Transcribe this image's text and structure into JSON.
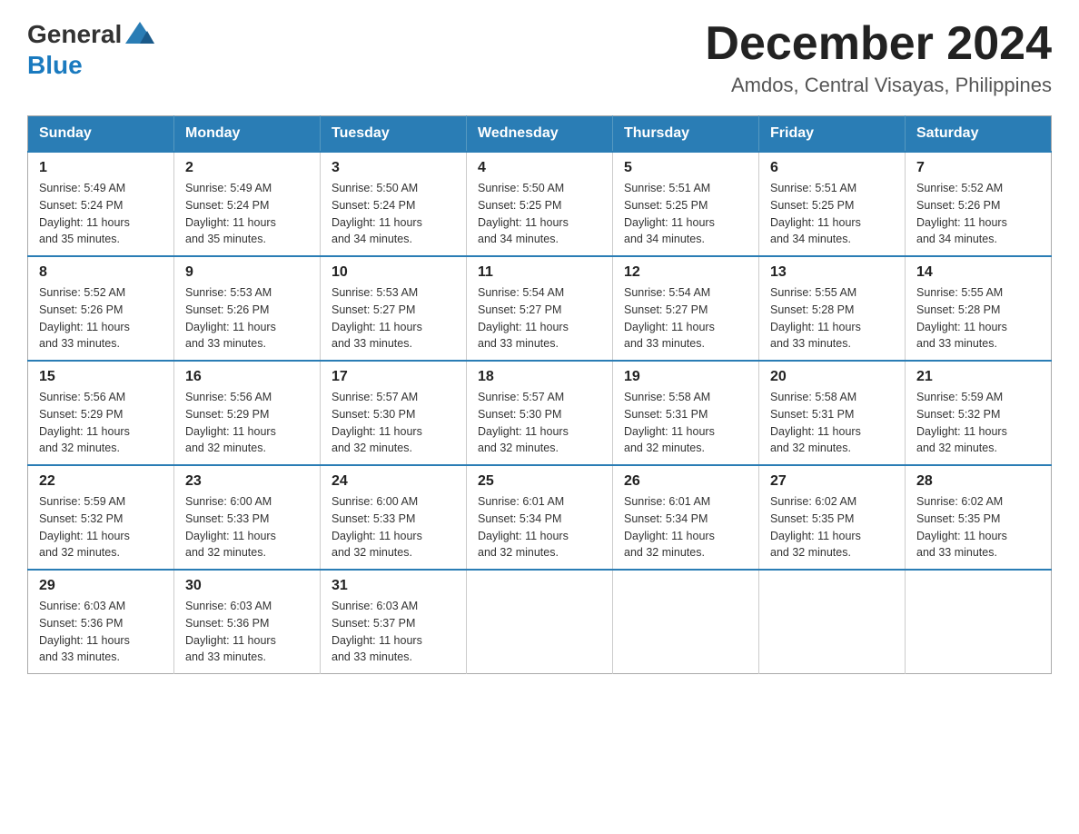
{
  "header": {
    "logo_general": "General",
    "logo_blue": "Blue",
    "month_title": "December 2024",
    "location": "Amdos, Central Visayas, Philippines"
  },
  "days_of_week": [
    "Sunday",
    "Monday",
    "Tuesday",
    "Wednesday",
    "Thursday",
    "Friday",
    "Saturday"
  ],
  "weeks": [
    [
      {
        "day": "1",
        "sunrise": "5:49 AM",
        "sunset": "5:24 PM",
        "daylight": "11 hours and 35 minutes."
      },
      {
        "day": "2",
        "sunrise": "5:49 AM",
        "sunset": "5:24 PM",
        "daylight": "11 hours and 35 minutes."
      },
      {
        "day": "3",
        "sunrise": "5:50 AM",
        "sunset": "5:24 PM",
        "daylight": "11 hours and 34 minutes."
      },
      {
        "day": "4",
        "sunrise": "5:50 AM",
        "sunset": "5:25 PM",
        "daylight": "11 hours and 34 minutes."
      },
      {
        "day": "5",
        "sunrise": "5:51 AM",
        "sunset": "5:25 PM",
        "daylight": "11 hours and 34 minutes."
      },
      {
        "day": "6",
        "sunrise": "5:51 AM",
        "sunset": "5:25 PM",
        "daylight": "11 hours and 34 minutes."
      },
      {
        "day": "7",
        "sunrise": "5:52 AM",
        "sunset": "5:26 PM",
        "daylight": "11 hours and 34 minutes."
      }
    ],
    [
      {
        "day": "8",
        "sunrise": "5:52 AM",
        "sunset": "5:26 PM",
        "daylight": "11 hours and 33 minutes."
      },
      {
        "day": "9",
        "sunrise": "5:53 AM",
        "sunset": "5:26 PM",
        "daylight": "11 hours and 33 minutes."
      },
      {
        "day": "10",
        "sunrise": "5:53 AM",
        "sunset": "5:27 PM",
        "daylight": "11 hours and 33 minutes."
      },
      {
        "day": "11",
        "sunrise": "5:54 AM",
        "sunset": "5:27 PM",
        "daylight": "11 hours and 33 minutes."
      },
      {
        "day": "12",
        "sunrise": "5:54 AM",
        "sunset": "5:27 PM",
        "daylight": "11 hours and 33 minutes."
      },
      {
        "day": "13",
        "sunrise": "5:55 AM",
        "sunset": "5:28 PM",
        "daylight": "11 hours and 33 minutes."
      },
      {
        "day": "14",
        "sunrise": "5:55 AM",
        "sunset": "5:28 PM",
        "daylight": "11 hours and 33 minutes."
      }
    ],
    [
      {
        "day": "15",
        "sunrise": "5:56 AM",
        "sunset": "5:29 PM",
        "daylight": "11 hours and 32 minutes."
      },
      {
        "day": "16",
        "sunrise": "5:56 AM",
        "sunset": "5:29 PM",
        "daylight": "11 hours and 32 minutes."
      },
      {
        "day": "17",
        "sunrise": "5:57 AM",
        "sunset": "5:30 PM",
        "daylight": "11 hours and 32 minutes."
      },
      {
        "day": "18",
        "sunrise": "5:57 AM",
        "sunset": "5:30 PM",
        "daylight": "11 hours and 32 minutes."
      },
      {
        "day": "19",
        "sunrise": "5:58 AM",
        "sunset": "5:31 PM",
        "daylight": "11 hours and 32 minutes."
      },
      {
        "day": "20",
        "sunrise": "5:58 AM",
        "sunset": "5:31 PM",
        "daylight": "11 hours and 32 minutes."
      },
      {
        "day": "21",
        "sunrise": "5:59 AM",
        "sunset": "5:32 PM",
        "daylight": "11 hours and 32 minutes."
      }
    ],
    [
      {
        "day": "22",
        "sunrise": "5:59 AM",
        "sunset": "5:32 PM",
        "daylight": "11 hours and 32 minutes."
      },
      {
        "day": "23",
        "sunrise": "6:00 AM",
        "sunset": "5:33 PM",
        "daylight": "11 hours and 32 minutes."
      },
      {
        "day": "24",
        "sunrise": "6:00 AM",
        "sunset": "5:33 PM",
        "daylight": "11 hours and 32 minutes."
      },
      {
        "day": "25",
        "sunrise": "6:01 AM",
        "sunset": "5:34 PM",
        "daylight": "11 hours and 32 minutes."
      },
      {
        "day": "26",
        "sunrise": "6:01 AM",
        "sunset": "5:34 PM",
        "daylight": "11 hours and 32 minutes."
      },
      {
        "day": "27",
        "sunrise": "6:02 AM",
        "sunset": "5:35 PM",
        "daylight": "11 hours and 32 minutes."
      },
      {
        "day": "28",
        "sunrise": "6:02 AM",
        "sunset": "5:35 PM",
        "daylight": "11 hours and 33 minutes."
      }
    ],
    [
      {
        "day": "29",
        "sunrise": "6:03 AM",
        "sunset": "5:36 PM",
        "daylight": "11 hours and 33 minutes."
      },
      {
        "day": "30",
        "sunrise": "6:03 AM",
        "sunset": "5:36 PM",
        "daylight": "11 hours and 33 minutes."
      },
      {
        "day": "31",
        "sunrise": "6:03 AM",
        "sunset": "5:37 PM",
        "daylight": "11 hours and 33 minutes."
      },
      null,
      null,
      null,
      null
    ]
  ],
  "labels": {
    "sunrise": "Sunrise:",
    "sunset": "Sunset:",
    "daylight": "Daylight:"
  }
}
